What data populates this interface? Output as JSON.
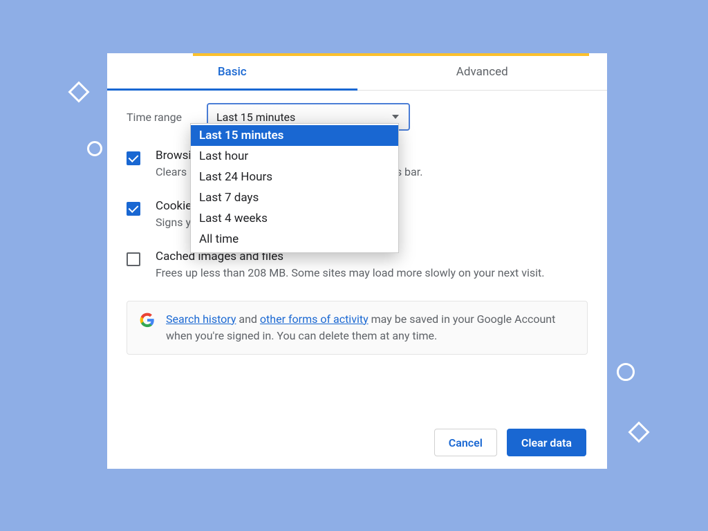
{
  "tabs": {
    "basic": "Basic",
    "advanced": "Advanced"
  },
  "time_range": {
    "label": "Time range",
    "selected": "Last 15 minutes",
    "options": [
      "Last 15 minutes",
      "Last hour",
      "Last 24 Hours",
      "Last 7 days",
      "Last 4 weeks",
      "All time"
    ]
  },
  "items": {
    "browsing": {
      "title": "Browsing history",
      "desc": "Clears history and autocompletions in the address bar.",
      "checked": true
    },
    "cookies": {
      "title": "Cookies and other site data",
      "desc": "Signs you out of most sites",
      "checked": true
    },
    "cache": {
      "title": "Cached images and files",
      "desc": "Frees up less than 208 MB. Some sites may load more slowly on your next visit.",
      "checked": false
    }
  },
  "info": {
    "link1": "Search history",
    "mid": " and ",
    "link2": "other forms of activity",
    "rest": " may be saved in your Google Account when you're signed in. You can delete them at any time."
  },
  "buttons": {
    "cancel": "Cancel",
    "clear": "Clear data"
  }
}
